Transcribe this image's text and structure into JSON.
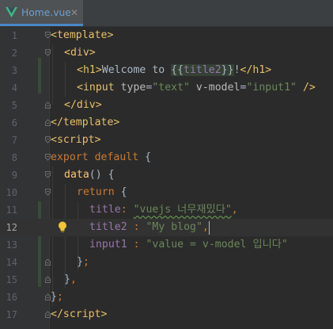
{
  "tab": {
    "filename": "Home.vue",
    "close_glyph": "✕",
    "icon": "vue-logo-icon"
  },
  "editor": {
    "current_line": 12,
    "lines": [
      {
        "num": "1"
      },
      {
        "num": "2"
      },
      {
        "num": "3"
      },
      {
        "num": "4"
      },
      {
        "num": "5"
      },
      {
        "num": "6"
      },
      {
        "num": "7"
      },
      {
        "num": "8"
      },
      {
        "num": "9"
      },
      {
        "num": "10"
      },
      {
        "num": "11"
      },
      {
        "num": "12"
      },
      {
        "num": "13"
      },
      {
        "num": "14"
      },
      {
        "num": "15"
      },
      {
        "num": "16"
      },
      {
        "num": "17"
      }
    ],
    "code": {
      "l1": {
        "open": "<",
        "tag": "template",
        "close": ">"
      },
      "l2": {
        "open": "<",
        "tag": "div",
        "close": ">"
      },
      "l3": {
        "open": "<",
        "tag": "h1",
        "close": ">",
        "text": "Welcome to ",
        "interp_open": "{{",
        "interp": "title2",
        "interp_close": "}}",
        "bang": "!",
        "end_open": "</",
        "end_tag": "h1",
        "end_close": ">"
      },
      "l4": {
        "open": "<",
        "tag": "input",
        "attr1": "type",
        "eq1": "=",
        "val1": "\"text\"",
        "attr2": "v-model",
        "eq2": "=",
        "val2": "\"input1\"",
        "close": "/>"
      },
      "l5": {
        "open": "</",
        "tag": "div",
        "close": ">"
      },
      "l6": {
        "open": "</",
        "tag": "template",
        "close": ">"
      },
      "l7": {
        "open": "<",
        "tag": "script",
        "close": ">"
      },
      "l8": {
        "kw": "export default",
        "brace": " {"
      },
      "l9": {
        "fn": "data",
        "rest": "() {"
      },
      "l10": {
        "kw": "return",
        "brace": " {"
      },
      "l11": {
        "prop": "title",
        "colon": ": ",
        "str": "\"vuejs 너무재밌다\"",
        "comma": ","
      },
      "l12": {
        "prop": "title2",
        "colon": " : ",
        "str": "\"My blog\"",
        "comma": ","
      },
      "l13": {
        "prop": "input1",
        "colon": " : ",
        "str": "\"value = v-model 입니다\""
      },
      "l14": {
        "brace": "}",
        "semi": ";"
      },
      "l15": {
        "brace": "}",
        "comma": ","
      },
      "l16": {
        "brace": "}",
        "semi": ";"
      },
      "l17": {
        "open": "</",
        "tag": "script",
        "close": ">"
      }
    }
  },
  "colors": {
    "background": "#2b2b2b",
    "gutter": "#313335",
    "tag": "#e8bf6a",
    "string": "#6a8759",
    "keyword": "#cc7832",
    "function": "#ffc66d",
    "property": "#9876aa",
    "text": "#a9b7c6",
    "tab_accent": "#4a88c7"
  },
  "icons": [
    "vue-logo-icon",
    "close-icon",
    "fold-icon",
    "intention-bulb-icon"
  ]
}
